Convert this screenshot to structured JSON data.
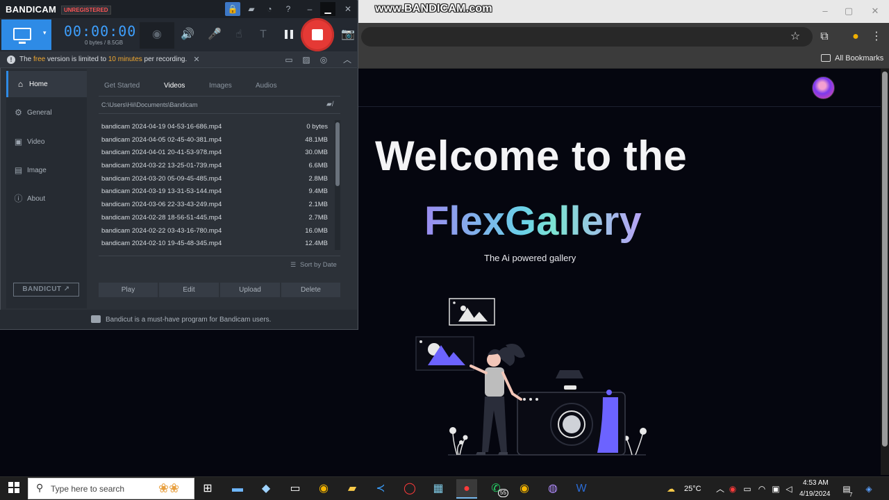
{
  "browser": {
    "watermark": "www.BANDICAM.com",
    "bookmarks_label": "All Bookmarks",
    "window_controls": [
      "–",
      "▢",
      "✕"
    ]
  },
  "page": {
    "heading": "Welcome to the",
    "brand": "FlexGallery",
    "tagline": "The Ai powered gallery"
  },
  "bandicam": {
    "logo": "BANDICAM",
    "registration": "UNREGISTERED",
    "timer": "00:00:00",
    "size": "0 bytes / 8.5GB",
    "notice": {
      "prefix": "The ",
      "free": "free",
      "middle": " version is limited to ",
      "limit": "10 minutes",
      "suffix": " per recording."
    },
    "sidebar": [
      {
        "label": "Home",
        "icon": "home-icon",
        "glyph": "⌂"
      },
      {
        "label": "General",
        "icon": "gear-icon",
        "glyph": "⚙"
      },
      {
        "label": "Video",
        "icon": "video-icon",
        "glyph": "▣"
      },
      {
        "label": "Image",
        "icon": "image-icon",
        "glyph": "▤"
      },
      {
        "label": "About",
        "icon": "info-icon",
        "glyph": "ⓘ"
      }
    ],
    "bandicut_label": "BANDICUT ↗",
    "tabs": [
      "Get Started",
      "Videos",
      "Images",
      "Audios"
    ],
    "active_tab": "Videos",
    "path": "C:\\Users\\Hii\\Documents\\Bandicam",
    "files": [
      {
        "name": "bandicam 2024-04-19 04-53-16-686.mp4",
        "size": "0 bytes"
      },
      {
        "name": "bandicam 2024-04-05 02-45-40-381.mp4",
        "size": "48.1MB"
      },
      {
        "name": "bandicam 2024-04-01 20-41-53-978.mp4",
        "size": "30.0MB"
      },
      {
        "name": "bandicam 2024-03-22 13-25-01-739.mp4",
        "size": "6.6MB"
      },
      {
        "name": "bandicam 2024-03-20 05-09-45-485.mp4",
        "size": "2.8MB"
      },
      {
        "name": "bandicam 2024-03-19 13-31-53-144.mp4",
        "size": "9.4MB"
      },
      {
        "name": "bandicam 2024-03-06 22-33-43-249.mp4",
        "size": "2.1MB"
      },
      {
        "name": "bandicam 2024-02-28 18-56-51-445.mp4",
        "size": "2.7MB"
      },
      {
        "name": "bandicam 2024-02-22 03-43-16-780.mp4",
        "size": "16.0MB"
      },
      {
        "name": "bandicam 2024-02-10 19-45-48-345.mp4",
        "size": "12.4MB"
      }
    ],
    "sort_label": "Sort by Date",
    "actions": [
      "Play",
      "Edit",
      "Upload",
      "Delete"
    ],
    "footer": "Bandicut is a must-have program for Bandicam users."
  },
  "taskbar": {
    "search_placeholder": "Type here to search",
    "weather": "25°C",
    "time": "4:53 AM",
    "date": "4/19/2024",
    "whatsapp_badge": "55",
    "notification_count": "7"
  },
  "colors": {
    "bandicam_accent": "#2e8be6",
    "timer": "#3ea0ff",
    "record_stop": "#e53935",
    "notice_highlight": "#f0a830",
    "illustration_accent": "#6c63ff"
  }
}
